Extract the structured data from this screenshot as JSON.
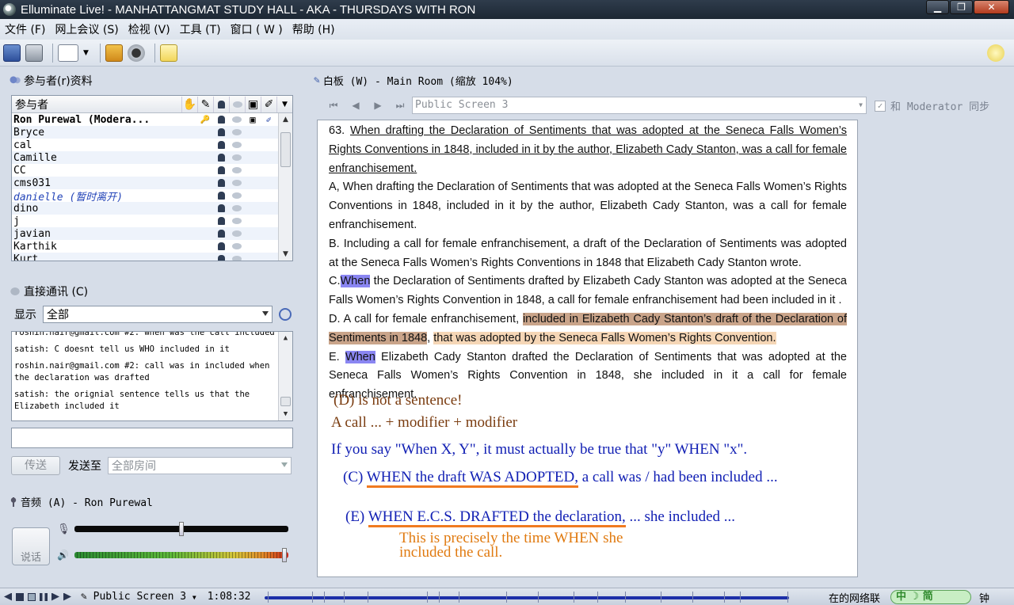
{
  "window": {
    "title": "Elluminate Live! - MANHATTANGMAT STUDY HALL - AKA - THURSDAYS WITH RON",
    "min": "▁",
    "max": "❐",
    "close": "✕"
  },
  "menu": [
    "文件 (F)",
    "网上会议 (S)",
    "检视 (V)",
    "工具 (T)",
    "窗口 ( W )",
    "帮助 (H)"
  ],
  "toolbar": {
    "icons": [
      "save-icon",
      "print-icon",
      "layout-icon",
      "transfer-icon",
      "webcam-icon",
      "notes-icon",
      "help-icon"
    ]
  },
  "participants": {
    "title": "参与者(r)资料",
    "header": "参与者",
    "rows": [
      {
        "name": "Ron Purewal (Modera...",
        "style": "bold"
      },
      {
        "name": "Bryce",
        "style": ""
      },
      {
        "name": "cal",
        "style": ""
      },
      {
        "name": "Camille",
        "style": ""
      },
      {
        "name": "CC",
        "style": ""
      },
      {
        "name": "cms031",
        "style": ""
      },
      {
        "name": "danielle (暂时离开)",
        "style": "away"
      },
      {
        "name": "dino",
        "style": ""
      },
      {
        "name": "j",
        "style": ""
      },
      {
        "name": "javian",
        "style": ""
      },
      {
        "name": "Karthik",
        "style": ""
      },
      {
        "name": "Kurt",
        "style": ""
      }
    ]
  },
  "chat": {
    "title": "直接通讯 (C)",
    "display_label": "显示",
    "display_value": "全部",
    "messages": [
      "roshin.nair@gmail.com #2: when was the call included",
      "satish: C doesnt tell us WHO included in it",
      "roshin.nair@gmail.com #2: call was in included when the declaration was drafted",
      "satish: the orignial sentence tells us that the Elizabeth included it"
    ],
    "send_button": "传送",
    "send_to_label": "发送至",
    "send_to_value": "全部房间"
  },
  "audio": {
    "title": "音频 (A) - Ron Purewal",
    "talk_label": "说话",
    "mic_level": 0.5,
    "speaker_level": 0.98
  },
  "whiteboard": {
    "title": "白板 (W) - Main Room (缩放 104%)",
    "screen": "Public Screen 3",
    "sync_check": "✓",
    "sync_label": "和 Moderator 同步",
    "question_num": "63.",
    "question": "When drafting the Declaration of Sentiments that was adopted at the Seneca Falls Women’s Rights Conventions in 1848, included in it by the author, Elizabeth Cady Stanton, was a call for female enfranchisement.",
    "option_a": "A, When drafting the Declaration of Sentiments that was adopted at the Seneca Falls Women’s Rights Conventions in 1848, included in it by the author, Elizabeth Cady Stanton, was a call for female enfranchisement.",
    "option_b": "B. Including a call for female enfranchisement, a draft of the Declaration of Sentiments was adopted at the Seneca Falls Women’s Rights Conventions in 1848 that Elizabeth Cady Stanton wrote.",
    "option_c_pre": "C.",
    "option_c_when": "When",
    "option_c_rest": "the Declaration of Sentiments drafted by Elizabeth Cady Stanton was adopted at the Seneca Falls Women’s Rights Convention in 1848, a call for female enfranchisement had been included in it .",
    "option_d_pre": "D. A call for female enfranchisement,",
    "option_d_hl1": "included in Elizabeth Cady Stanton’s draft of the Declaration of Sentiments in 1848",
    "option_d_comma": ",",
    "option_d_hl2": "that was adopted by the Seneca Falls Women’s Rights Convention.",
    "option_e_pre": "E.",
    "option_e_when": "When",
    "option_e_rest": "Elizabeth Cady Stanton drafted the Declaration of Sentiments that was adopted at the Seneca Falls Women’s Rights Convention in 1848, she included in it a call for female enfranchisement.",
    "notes": {
      "n1": "(D) is not a sentence!",
      "n2": "A call ... + modifier + modifier",
      "n3": "If you say \"When X, Y\", it must actually be true that \"y\"  WHEN \"x\".",
      "n4a": "(C)",
      "n4b": "WHEN the draft WAS ADOPTED,",
      "n4c": " a call was / had been included ...",
      "n5a": "(E)",
      "n5b": "WHEN E.C.S. DRAFTED the declaration,",
      "n5c": " ... she included ...",
      "n6": "This is precisely the time WHEN she",
      "n7": "included the call."
    }
  },
  "status": {
    "screen": "Public Screen 3",
    "time": "1:08:32",
    "right_text": "在的网络联",
    "right_suffix": "钟",
    "ime": "中 ☽ 简"
  },
  "colors": {
    "highlight_blue": "#8a86f2",
    "highlight_brown": "#c9a48a",
    "ink_blue": "#1220b4",
    "ink_orange": "#e07a10",
    "ink_brown": "#7a3c10"
  }
}
